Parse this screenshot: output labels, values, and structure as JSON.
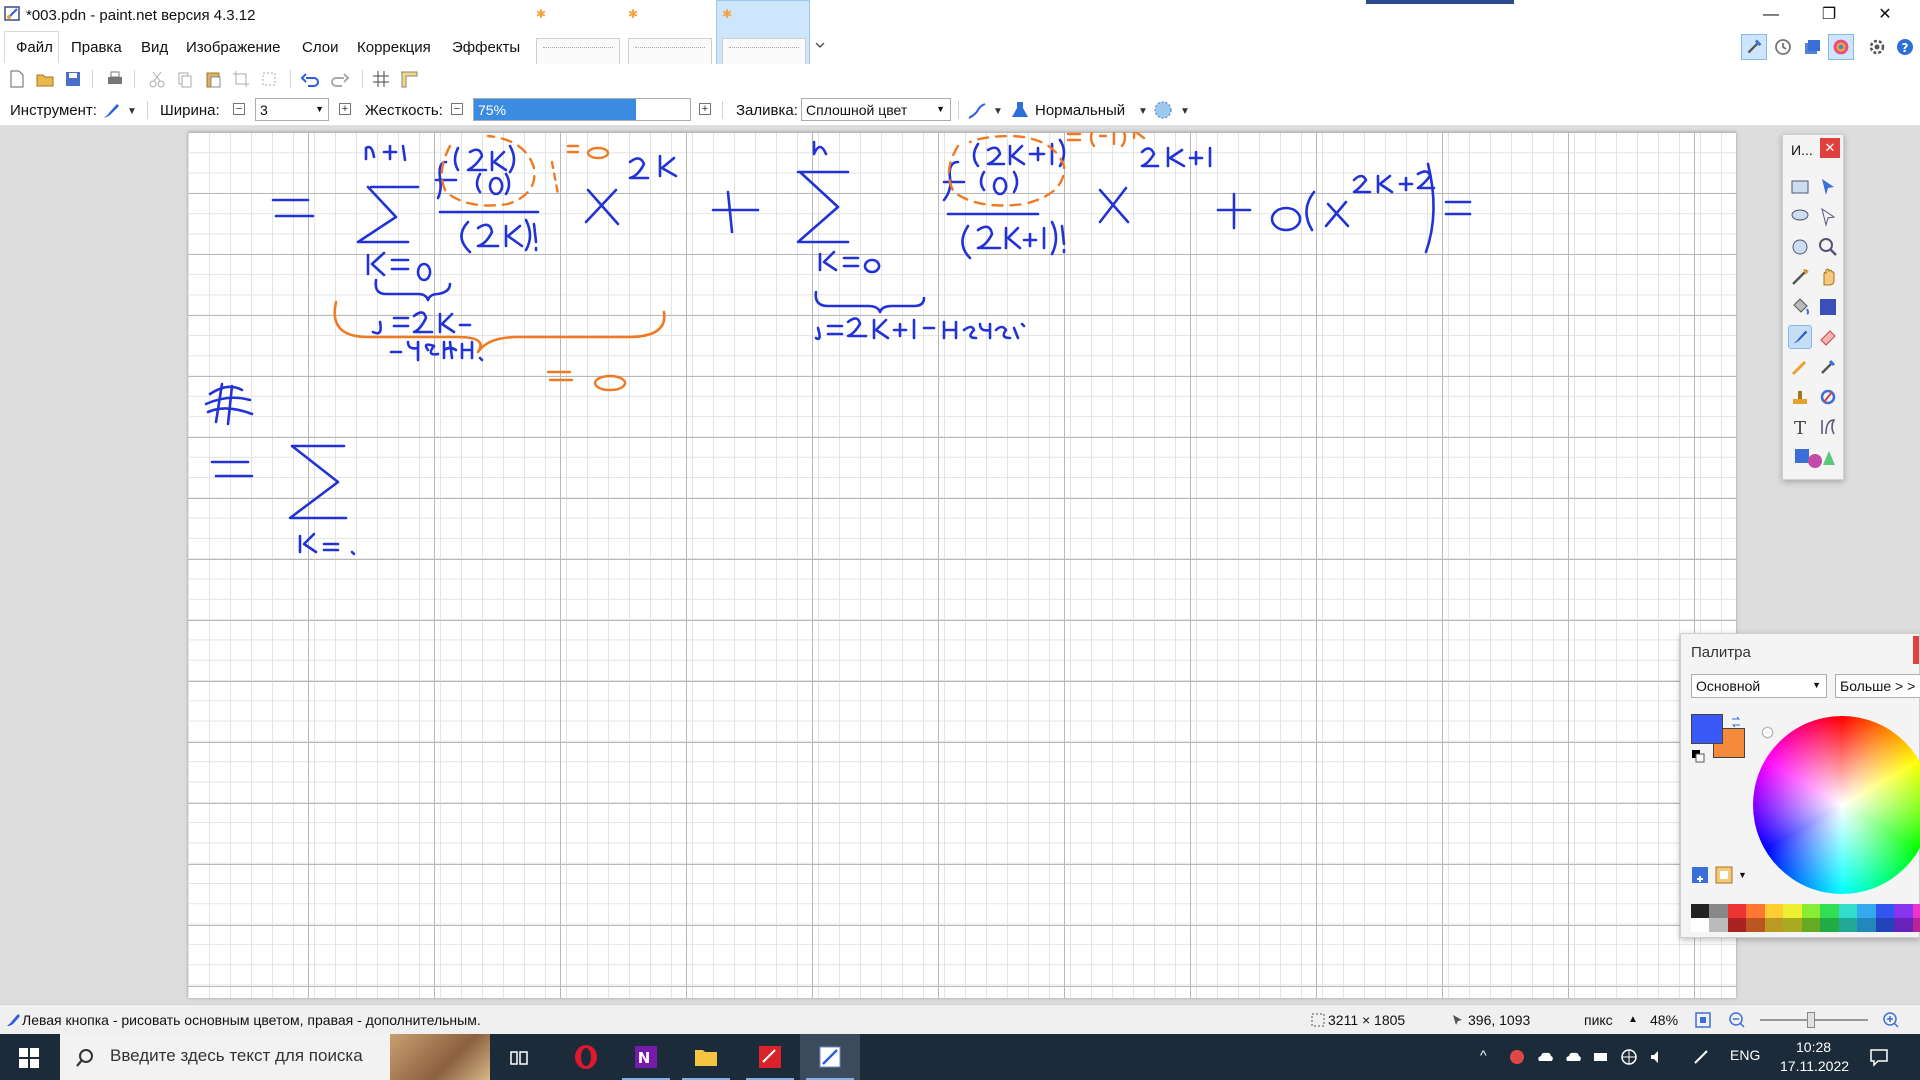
{
  "window": {
    "title": "*003.pdn - paint.net версия 4.3.12",
    "controls": [
      "—",
      "❐",
      "✕"
    ]
  },
  "menu": {
    "items": [
      "Файл",
      "Правка",
      "Вид",
      "Изображение",
      "Слои",
      "Коррекция",
      "Эффекты"
    ]
  },
  "toolbar2": {
    "tool_label": "Инструмент:",
    "width_label": "Ширина:",
    "width_value": "3",
    "hardness_label": "Жесткость:",
    "hardness_value": "75%",
    "hardness_fraction": 0.75,
    "fill_label": "Заливка:",
    "fill_value": "Сплошной цвет",
    "blend_value": "Нормальный"
  },
  "tools_window": {
    "title": "И...",
    "close": "✕"
  },
  "palette": {
    "title": "Палитра",
    "mode_value": "Основной",
    "more_label": "Больше > >",
    "primary_color": "#3a58f5",
    "secondary_color": "#f58a3a"
  },
  "status": {
    "hint": "Левая кнопка - рисовать основным цветом, правая - дополнительным.",
    "image_size": "3211 × 1805",
    "cursor_pos": "396, 1093",
    "units": "пикс",
    "zoom": "48%"
  },
  "taskbar": {
    "search_placeholder": "Введите здесь текст для поиска",
    "lang": "ENG",
    "time": "10:28",
    "date": "17.11.2022"
  },
  "colors": {
    "ink_blue": "#2233d6",
    "ink_orange": "#f07a24",
    "accent": "#3b8be0"
  }
}
